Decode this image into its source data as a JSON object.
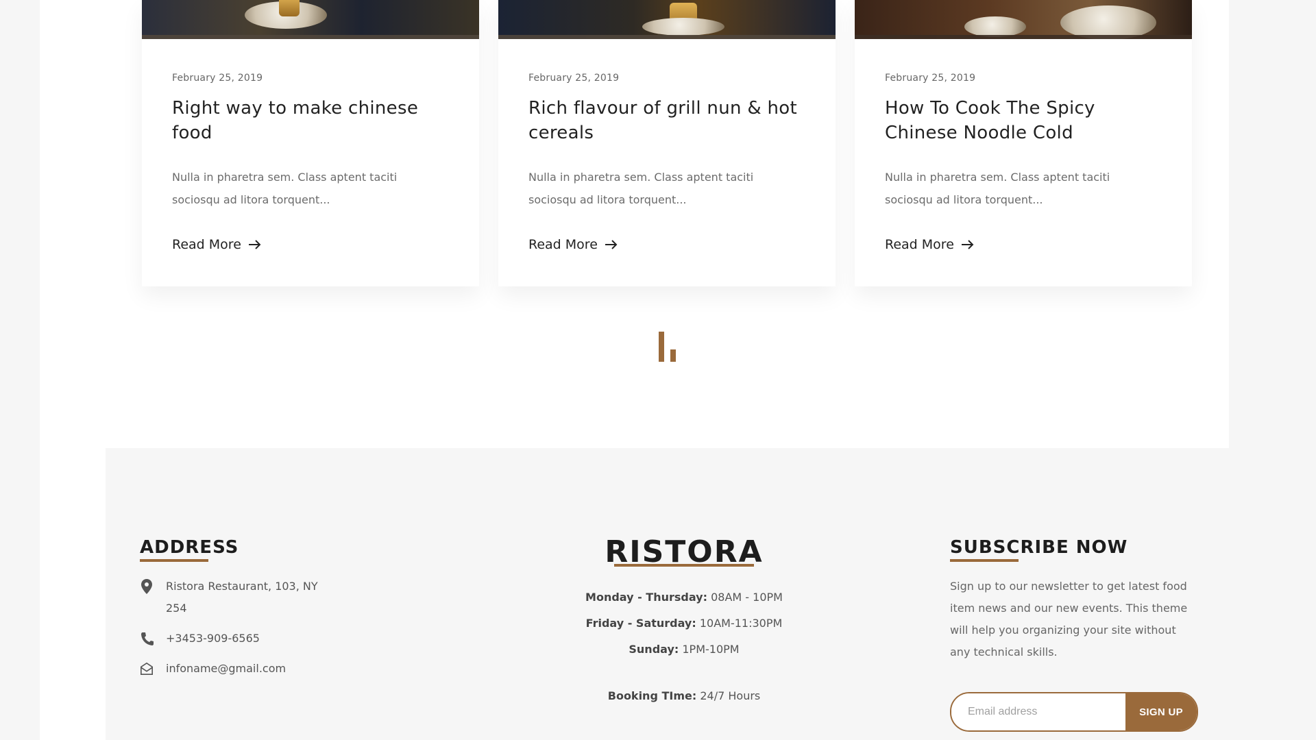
{
  "blog": {
    "posts": [
      {
        "date": "February 25, 2019",
        "title": "Right way to make chinese food",
        "excerpt": "Nulla in pharetra sem. Class aptent taciti sociosqu ad litora torquent...",
        "read_more": "Read More"
      },
      {
        "date": "February 25, 2019",
        "title": "Rich flavour of grill nun & hot cereals",
        "excerpt": "Nulla in pharetra sem. Class aptent taciti sociosqu ad litora torquent...",
        "read_more": "Read More"
      },
      {
        "date": "February 25, 2019",
        "title": "How To Cook The Spicy Chinese Noodle Cold",
        "excerpt": "Nulla in pharetra sem. Class aptent taciti sociosqu ad litora torquent...",
        "read_more": "Read More"
      }
    ]
  },
  "footer": {
    "address": {
      "heading": "ADDRESS",
      "location": "Ristora Restaurant, 103, NY 254",
      "phone": "+3453-909-6565",
      "email": "infoname@gmail.com"
    },
    "brand": {
      "name": "RISTORA",
      "hours": [
        {
          "days": "Monday - Thursday:",
          "time": "08AM - 10PM"
        },
        {
          "days": "Friday - Saturday:",
          "time": "10AM-11:30PM"
        },
        {
          "days": "Sunday:",
          "time": "1PM-10PM"
        }
      ],
      "booking_label": "Booking TIme:",
      "booking_value": "24/7 Hours"
    },
    "subscribe": {
      "heading": "SUBSCRIBE NOW",
      "text": "Sign up to our newsletter to get latest food item news and our new events. This theme will help you organizing your site without any technical skills.",
      "email_placeholder": "Email address",
      "button": "SIGN UP"
    }
  },
  "icons": {
    "read_more": "arrow-right-icon",
    "location": "map-pin-icon",
    "phone": "phone-icon",
    "email": "envelope-icon",
    "loader": "loading-bars-icon"
  },
  "colors": {
    "accent": "#9a6a3b",
    "text_dark": "#222222",
    "text_muted": "#6b6b6b",
    "footer_bg": "#f6f6f6"
  }
}
